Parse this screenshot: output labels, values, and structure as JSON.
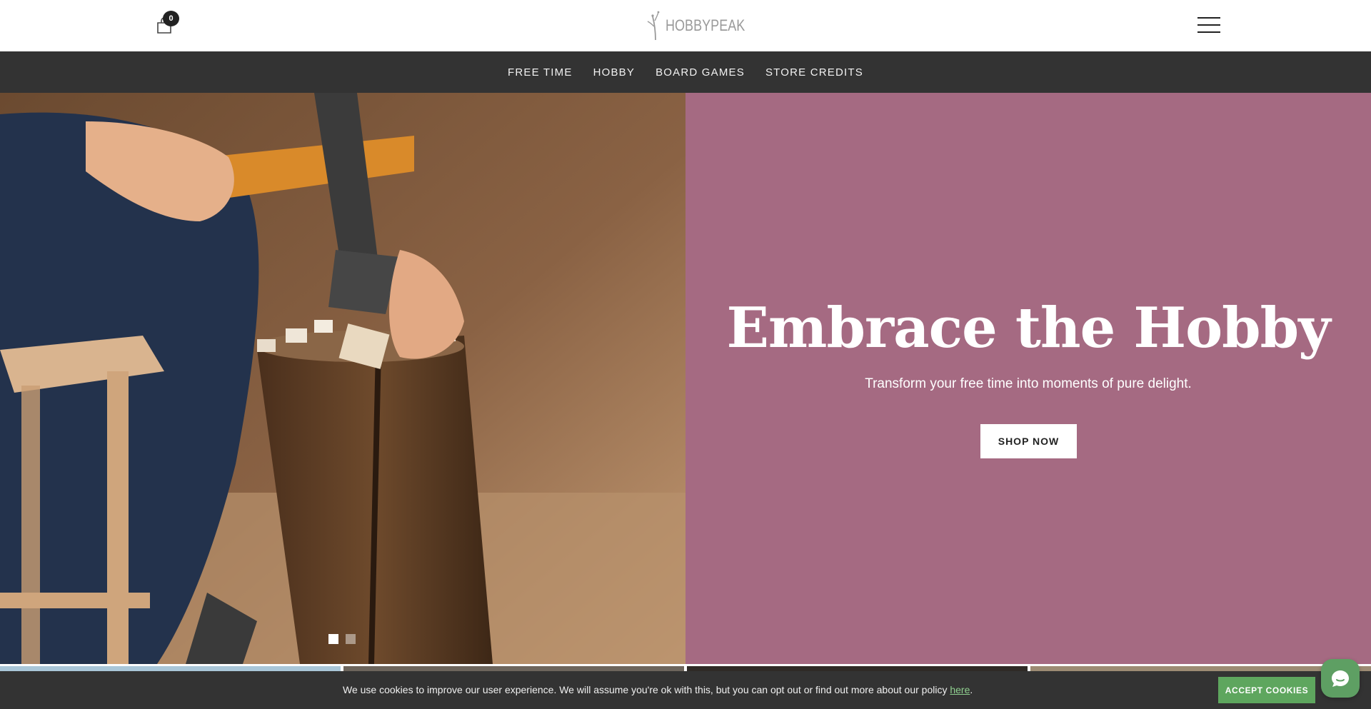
{
  "header": {
    "cart_count": "0",
    "logo_text": "HOBBYPEAK"
  },
  "nav": {
    "items": [
      "FREE TIME",
      "HOBBY",
      "BOARD GAMES",
      "STORE CREDITS"
    ]
  },
  "hero": {
    "title": "Embrace the Hobby",
    "subtitle": "Transform your free time into moments of pure delight.",
    "cta_label": "SHOP NOW",
    "panel_color": "#a56a82"
  },
  "cookie": {
    "text": "We use cookies to improve our user experience. We will assume you're ok with this, but you can opt out or find out more about our policy ",
    "link_text": "here",
    "suffix": ".",
    "accept_label": "ACCEPT COOKIES"
  },
  "icons": {
    "cart": "shopping-bag-icon",
    "menu": "hamburger-icon",
    "chat": "chat-bubble-icon",
    "logo": "branch-icon"
  }
}
